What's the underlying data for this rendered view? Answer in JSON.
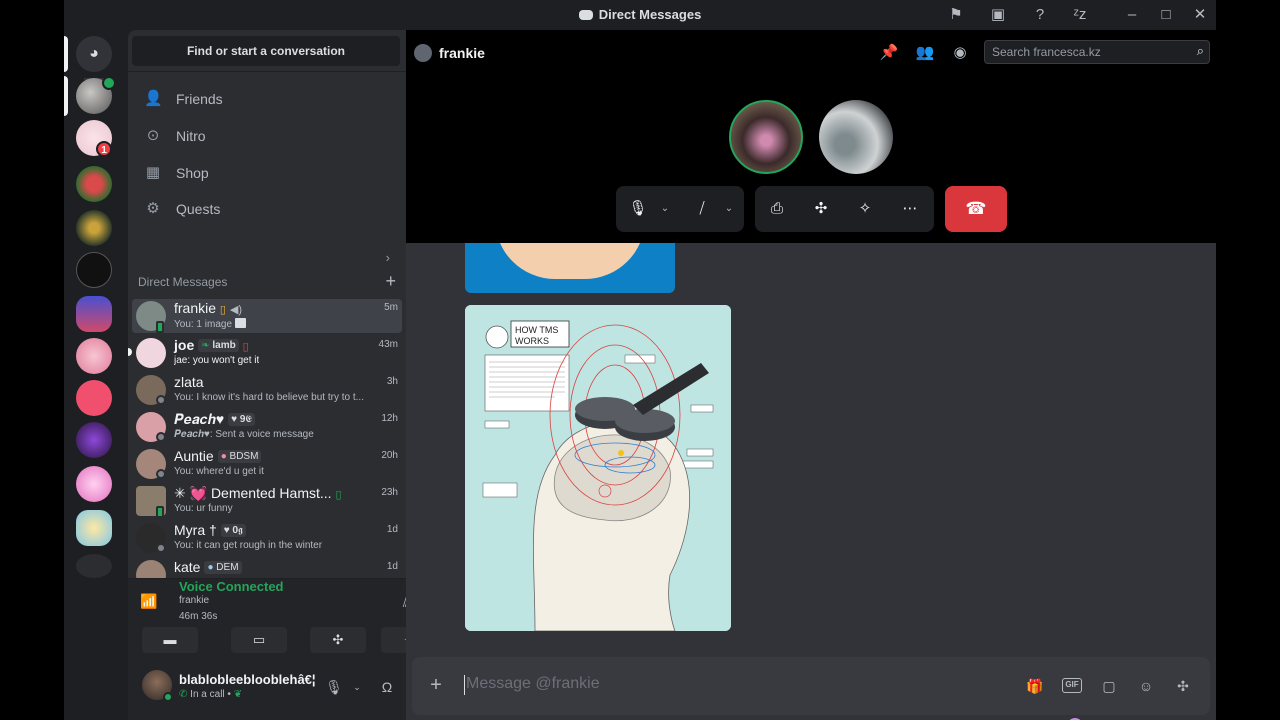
{
  "window": {
    "title": "Direct Messages"
  },
  "sidebar": {
    "find_label": "Find or start a conversation",
    "nav": [
      {
        "label": "Friends",
        "icon": "friends-icon"
      },
      {
        "label": "Nitro",
        "icon": "nitro-icon"
      },
      {
        "label": "Shop",
        "icon": "shop-icon"
      },
      {
        "label": "Quests",
        "icon": "quests-icon"
      }
    ],
    "dm_header": "Direct Messages",
    "dms": [
      {
        "name": "frankie",
        "sub": "You: 1 image",
        "time": "5m",
        "active": true,
        "status": "mobile",
        "avatar_color": "#7d8a85"
      },
      {
        "name": "joe",
        "tag": "lamb",
        "sub": "jae: you won't get it",
        "time": "43m",
        "status": "mobile",
        "avatar_color": "#f0d6de"
      },
      {
        "name": "zlata",
        "sub": "You: I know it's hard to believe but try to t...",
        "time": "3h",
        "status": "idle",
        "avatar_color": "#7a6a5b"
      },
      {
        "name": "𝑷𝒆𝒂𝒄𝒉♥",
        "tag": "♥ 𝟗𝕰",
        "sub": "𝑷𝒆𝒂𝒄𝒉♥: Sent a voice message",
        "time": "12h",
        "status": "offline",
        "avatar_color": "#d9a0a7"
      },
      {
        "name": "Auntie",
        "tag": "BDSM",
        "sub": "You: where'd u get it",
        "time": "20h",
        "status": "offline",
        "avatar_color": "#a4877a"
      },
      {
        "name": "✳ 💓 Demented Hamst...",
        "sub": "You: ur funny",
        "time": "23h",
        "status": "mobile",
        "avatar_color": "#8a7d6b"
      },
      {
        "name": "Myra †",
        "tag": "♥ 𝟎𝖌",
        "sub": "You: it can get rough in the winter",
        "time": "1d",
        "status": "offline",
        "avatar_color": "#2a2a2a"
      },
      {
        "name": "kate",
        "tag": "DEM",
        "sub": "",
        "time": "1d",
        "status": "offline",
        "avatar_color": "#9a8274"
      }
    ]
  },
  "voice": {
    "title": "Voice Connected",
    "channel": "frankie",
    "elapsed": "46m 36s"
  },
  "user": {
    "name": "blablobleeblooblehâ€¦",
    "status": "In a call •"
  },
  "main": {
    "channel_name": "frankie",
    "search_placeholder": "Search francesca.kz",
    "composer_placeholder": "Message @frankie"
  },
  "image": {
    "title_line1": "HOW TMS",
    "title_line2": "WORKS"
  },
  "colors": {
    "accent_green": "#23a55a",
    "danger_red": "#da373c",
    "notification_red": "#f23f43"
  }
}
